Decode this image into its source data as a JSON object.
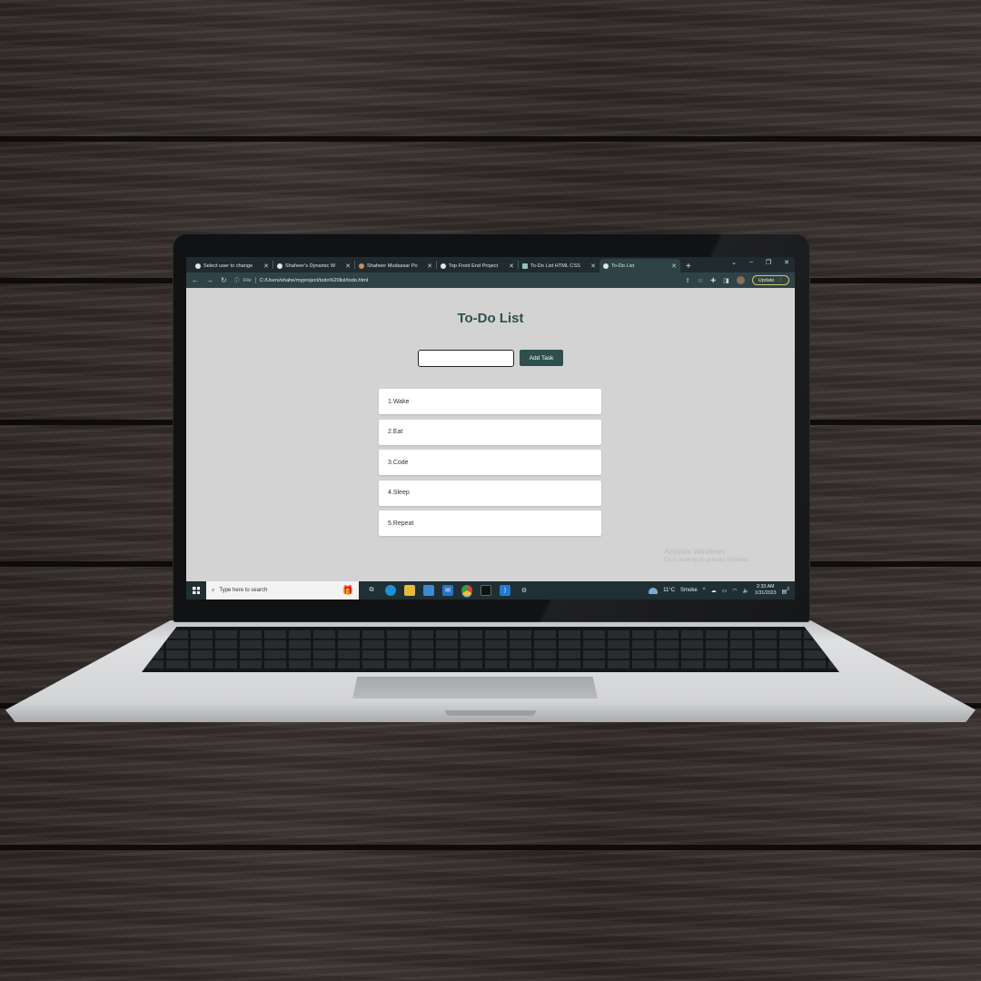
{
  "browser": {
    "tabs": [
      {
        "label": "Select user to change",
        "active": false
      },
      {
        "label": "Shaheer's Dynamic W",
        "active": false
      },
      {
        "label": "Shaheer Mudassar Po",
        "active": false
      },
      {
        "label": "Top Front End Project",
        "active": false
      },
      {
        "label": "To-Do List HTML CSS",
        "active": false
      },
      {
        "label": "To-Do List",
        "active": true
      }
    ],
    "new_tab": "+",
    "address": {
      "file_chip": "File",
      "url": "C:/Users/shahe/myproject/todo%20list/todo.html"
    },
    "update_label": "Update"
  },
  "page": {
    "title": "To-Do List",
    "input_value": "",
    "add_button_label": "Add Task",
    "tasks": [
      "1.Wake",
      "2.Eat",
      "3.Code",
      "4.Sleep",
      "5.Repeat"
    ]
  },
  "watermark": {
    "title": "Activate Windows",
    "subtitle": "Go to Settings to activate Windows."
  },
  "taskbar": {
    "search_placeholder": "Type here to search",
    "weather_temp": "11°C",
    "weather_desc": "Smoke",
    "time": "2:33 AM",
    "date": "1/31/2023",
    "notification_count": "2"
  },
  "colors": {
    "accent": "#2f4f4f",
    "page_bg": "#d3d3d3",
    "chrome_dark": "#1f2b2e",
    "chrome_toolbar": "#2f4347"
  }
}
